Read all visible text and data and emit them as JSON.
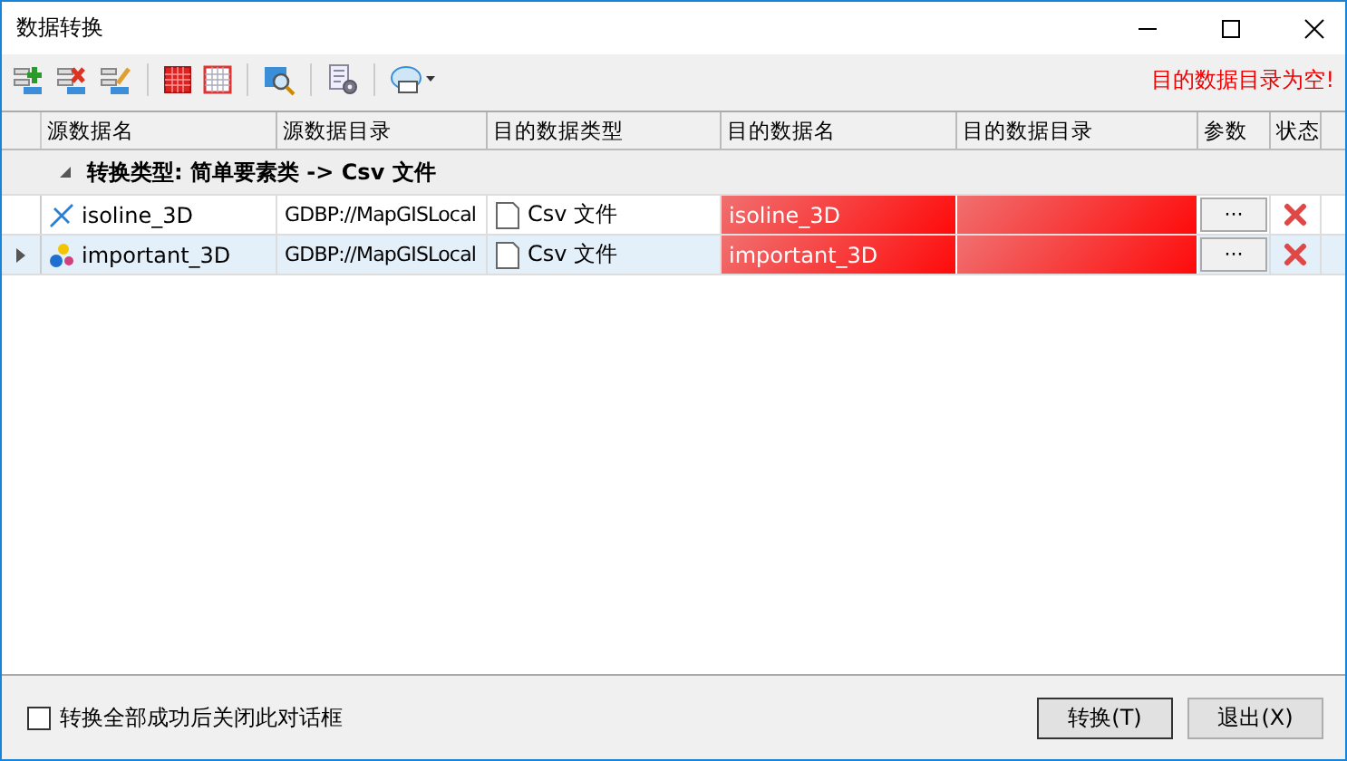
{
  "window": {
    "title": "数据转换"
  },
  "message": "目的数据目录为空!",
  "table": {
    "columns": [
      "源数据名",
      "源数据目录",
      "目的数据类型",
      "目的数据名",
      "目的数据目录",
      "参数",
      "状态"
    ],
    "group": {
      "label": "转换类型: 简单要素类 -> Csv 文件",
      "expanded": true
    },
    "rows": [
      {
        "kind": "line",
        "name": "isoline_3D",
        "source_dir": "GDBP://MapGISLocal",
        "dest_type": "Csv 文件",
        "dest_name": "isoline_3D",
        "params": "···",
        "error": true,
        "selected": false
      },
      {
        "kind": "point",
        "name": "important_3D",
        "source_dir": "GDBP://MapGISLocal",
        "dest_type": "Csv 文件",
        "dest_name": "important_3D",
        "params": "···",
        "error": true,
        "selected": true
      }
    ]
  },
  "close_checkbox": {
    "label": "转换全部成功后关闭此对话框",
    "checked": false
  },
  "buttons": [
    {
      "label": "转换(T)",
      "default": true
    },
    {
      "label": "退出(X)",
      "default": false
    }
  ]
}
